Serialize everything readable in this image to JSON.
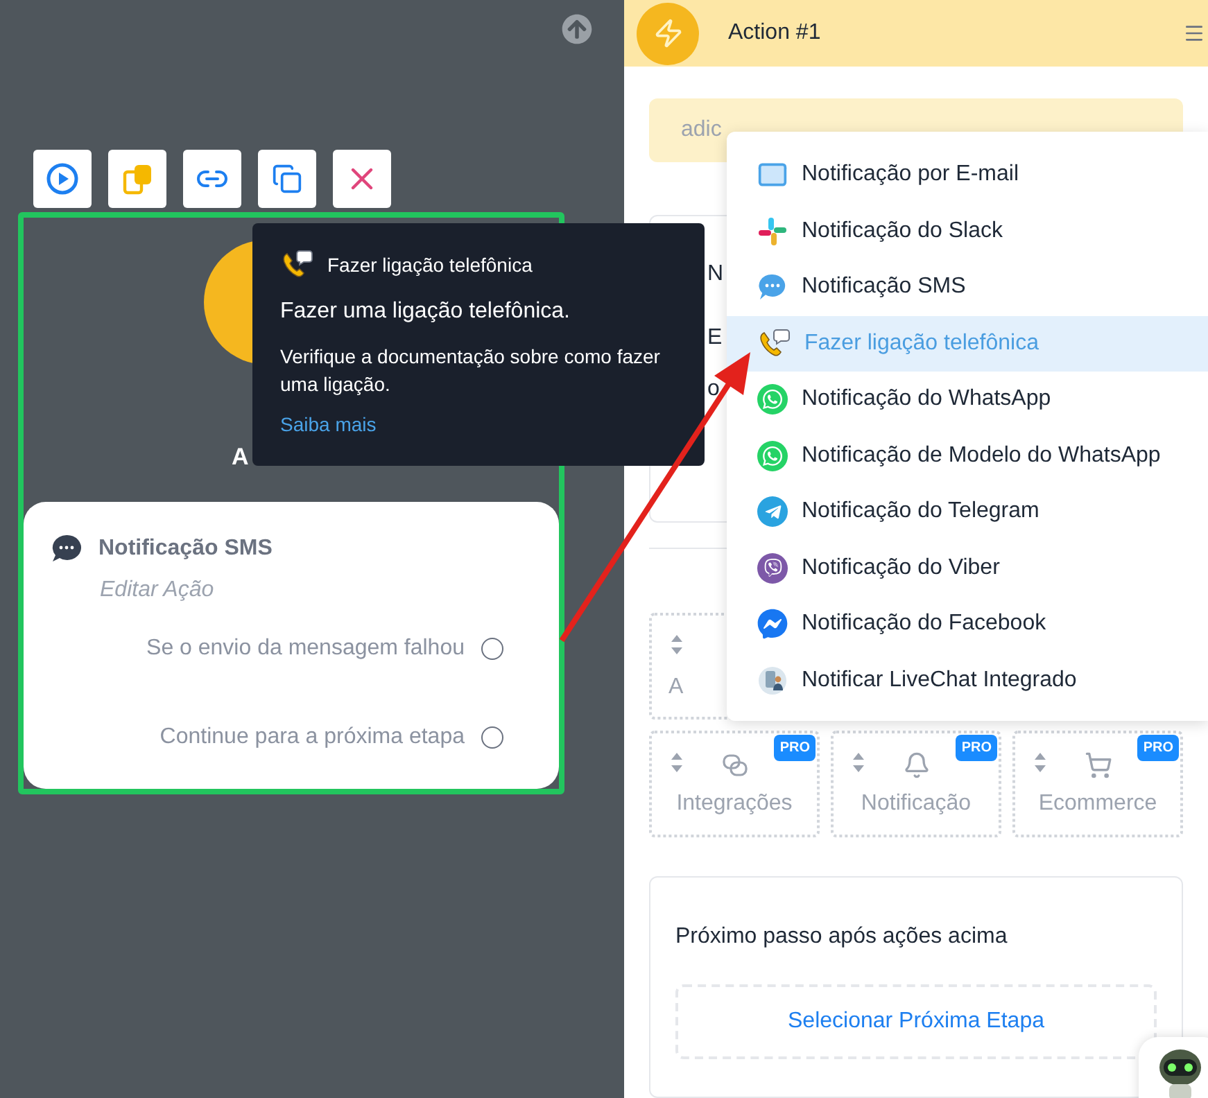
{
  "canvas": {
    "toolbar": [
      {
        "kind": "play"
      },
      {
        "kind": "copy"
      },
      {
        "kind": "link"
      },
      {
        "kind": "duplicate"
      },
      {
        "kind": "delete"
      }
    ],
    "node": {
      "title_fragment": "A",
      "card": {
        "title": "Notificação SMS",
        "subtitle": "Editar Ação",
        "outputs": [
          {
            "label": "Se o envio da mensagem falhou"
          },
          {
            "label": "Continue para a próxima etapa"
          }
        ]
      }
    }
  },
  "tooltip": {
    "heading": "Fazer ligação telefônica",
    "title": "Fazer uma ligação telefônica.",
    "body": "Verifique a documentação sobre como fazer uma ligação.",
    "link": "Saiba mais"
  },
  "header": {
    "title": "Action #1"
  },
  "select": {
    "placeholder": "adic"
  },
  "hidden_card": {
    "fragments": [
      "N",
      "E",
      "o"
    ]
  },
  "action_cards": [
    {
      "label": "A",
      "kind": "plain",
      "pro": false
    },
    {
      "label": "Integrações",
      "kind": "integrations",
      "pro": true,
      "badge": "PRO"
    },
    {
      "label": "Notificação",
      "kind": "notification",
      "pro": true,
      "badge": "PRO"
    },
    {
      "label": "Ecommerce",
      "kind": "ecommerce",
      "pro": true,
      "badge": "PRO"
    }
  ],
  "menu": {
    "items": [
      {
        "label": "Notificação por E-mail",
        "kind": "email",
        "selected": false
      },
      {
        "label": "Notificação do Slack",
        "kind": "slack",
        "selected": false
      },
      {
        "label": "Notificação SMS",
        "kind": "sms",
        "selected": false
      },
      {
        "label": "Fazer ligação telefônica",
        "kind": "phone",
        "selected": true
      },
      {
        "label": "Notificação do WhatsApp",
        "kind": "whatsapp",
        "selected": false
      },
      {
        "label": "Notificação de Modelo do WhatsApp",
        "kind": "whatsapp",
        "selected": false
      },
      {
        "label": "Notificação do Telegram",
        "kind": "telegram",
        "selected": false
      },
      {
        "label": "Notificação do Viber",
        "kind": "viber",
        "selected": false
      },
      {
        "label": "Notificação do Facebook",
        "kind": "messenger",
        "selected": false
      },
      {
        "label": "Notificar LiveChat Integrado",
        "kind": "livechat",
        "selected": false
      }
    ]
  },
  "next_step": {
    "title": "Próximo passo após ações acima",
    "button": "Selecionar Próxima Etapa"
  }
}
